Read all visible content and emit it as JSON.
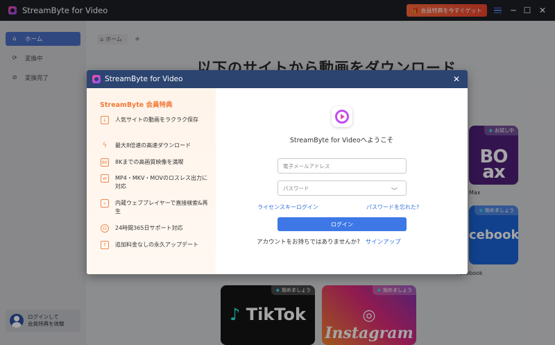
{
  "titlebar": {
    "title": "StreamByte for Video",
    "promo_label": "会員特典を今すぐゲット",
    "promo_icon": "gift-icon",
    "accent": "#f2452f"
  },
  "sidebar": {
    "items": [
      {
        "label": "ホーム",
        "icon": "home-icon",
        "active": true
      },
      {
        "label": "変換中",
        "icon": "convert-icon",
        "active": false
      },
      {
        "label": "変換完了",
        "icon": "check-circle-icon",
        "active": false
      }
    ],
    "login_card": {
      "line1": "ログインして",
      "line2": "会員特典を体験"
    }
  },
  "main": {
    "tab_label": "ホーム",
    "headline": "以下のサイトから動画をダウンロード",
    "cards": [
      {
        "name": "HBO Max",
        "logo": "BO",
        "logo2": "ax",
        "caption": "Max",
        "badge": "お試し中"
      },
      {
        "name": "Facebook",
        "logo": "cebook",
        "caption": "Facebook",
        "badge": "始めましょう"
      },
      {
        "name": "TikTok",
        "logo": "TikTok",
        "badge": "始めましょう"
      },
      {
        "name": "Instagram",
        "logo": "Instagram",
        "badge": "始めましょう"
      }
    ]
  },
  "modal": {
    "title": "StreamByte for Video",
    "benefits_title": "StreamByte 会員特典",
    "benefits": [
      {
        "text": "人気サイトの動画をラクラク保存",
        "icon": "download-box-icon"
      },
      {
        "text": "最大8倍速の高速ダウンロード",
        "icon": "lightning-icon"
      },
      {
        "text": "8Kまでの高画質映像を満喫",
        "icon": "8k-icon"
      },
      {
        "text": "MP4・MKV・MOVのロスレス出力に対応",
        "icon": "file-convert-icon"
      },
      {
        "text": "内蔵ウェブプレイヤーで直接検索&再生",
        "icon": "search-play-icon"
      },
      {
        "text": "24時間365日サポート対応",
        "icon": "headset-icon"
      },
      {
        "text": "追加料金なしの永久アップデート",
        "icon": "update-icon"
      }
    ],
    "welcome": "StreamByte for Videoへようこそ",
    "email_placeholder": "電子メールアドレス",
    "password_placeholder": "パスワード",
    "license_link": "ライセンスキーログイン",
    "forgot_link": "パスワードを忘れた?",
    "login_label": "ログイン",
    "no_account": "アカウントをお持ちではありませんか?",
    "signup_link": "サインアップ"
  }
}
